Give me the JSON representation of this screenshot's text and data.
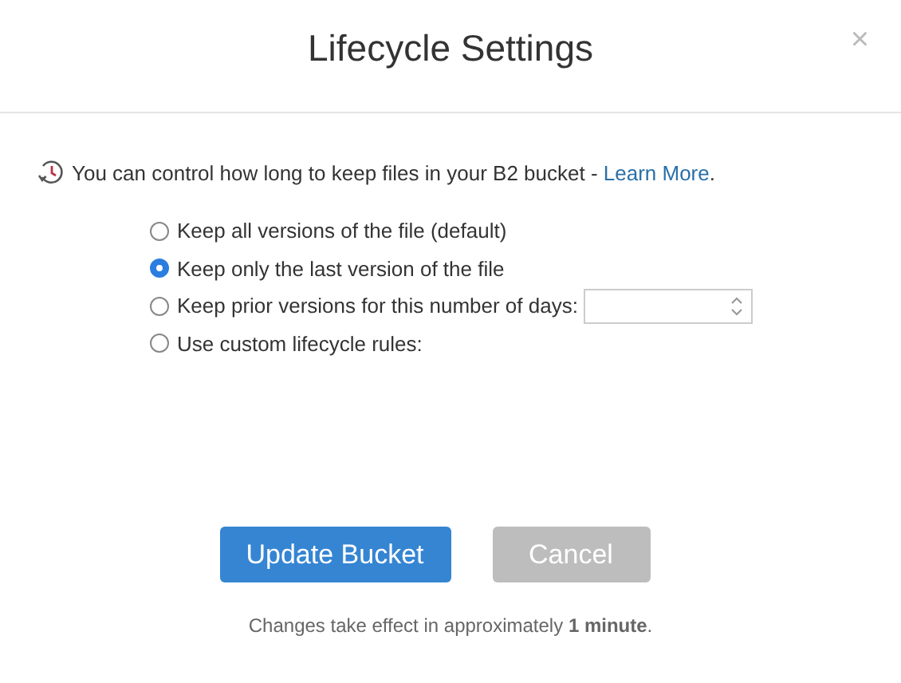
{
  "dialog": {
    "title": "Lifecycle Settings",
    "close": "×"
  },
  "intro": {
    "text": "You can control how long to keep files in your B2 bucket - ",
    "link": "Learn More",
    "end": "."
  },
  "options": [
    {
      "kind": "plain",
      "label": "Keep all versions of the file (default)",
      "selected": false
    },
    {
      "kind": "plain",
      "label": "Keep only the last version of the file",
      "selected": true
    },
    {
      "kind": "days",
      "label": "Keep prior versions for this number of days:",
      "selected": false
    },
    {
      "kind": "plain",
      "label": "Use custom lifecycle rules:",
      "selected": false
    }
  ],
  "buttons": [
    {
      "kind": "primary",
      "label": "Update Bucket"
    },
    {
      "kind": "secondary",
      "label": "Cancel"
    }
  ],
  "footer": "Changes take effect in approximately **1 minute**."
}
